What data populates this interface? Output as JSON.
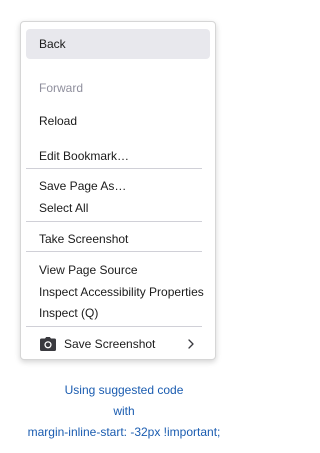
{
  "menu": {
    "items": {
      "back": "Back",
      "forward": "Forward",
      "reload": "Reload",
      "edit_bookmark": "Edit Bookmark…",
      "save_page_as": "Save Page As…",
      "select_all": "Select All",
      "take_screenshot": "Take Screenshot",
      "view_page_source": "View Page Source",
      "inspect_accessibility": "Inspect Accessibility Properties",
      "inspect": "Inspect (Q)",
      "save_screenshot": "Save Screenshot"
    },
    "hovered_item": "Back",
    "disabled_items": [
      "Forward"
    ]
  },
  "caption": {
    "line1": "Using suggested code",
    "line2": "with",
    "line3": "margin-inline-start: -32px !important;"
  },
  "colors": {
    "hover_bg": "#e8e8ed",
    "disabled_text": "#8f8f9d",
    "caption_text": "#1a5cb0"
  },
  "icons": {
    "save_screenshot": "camera-icon",
    "submenu": "chevron-right-icon"
  }
}
